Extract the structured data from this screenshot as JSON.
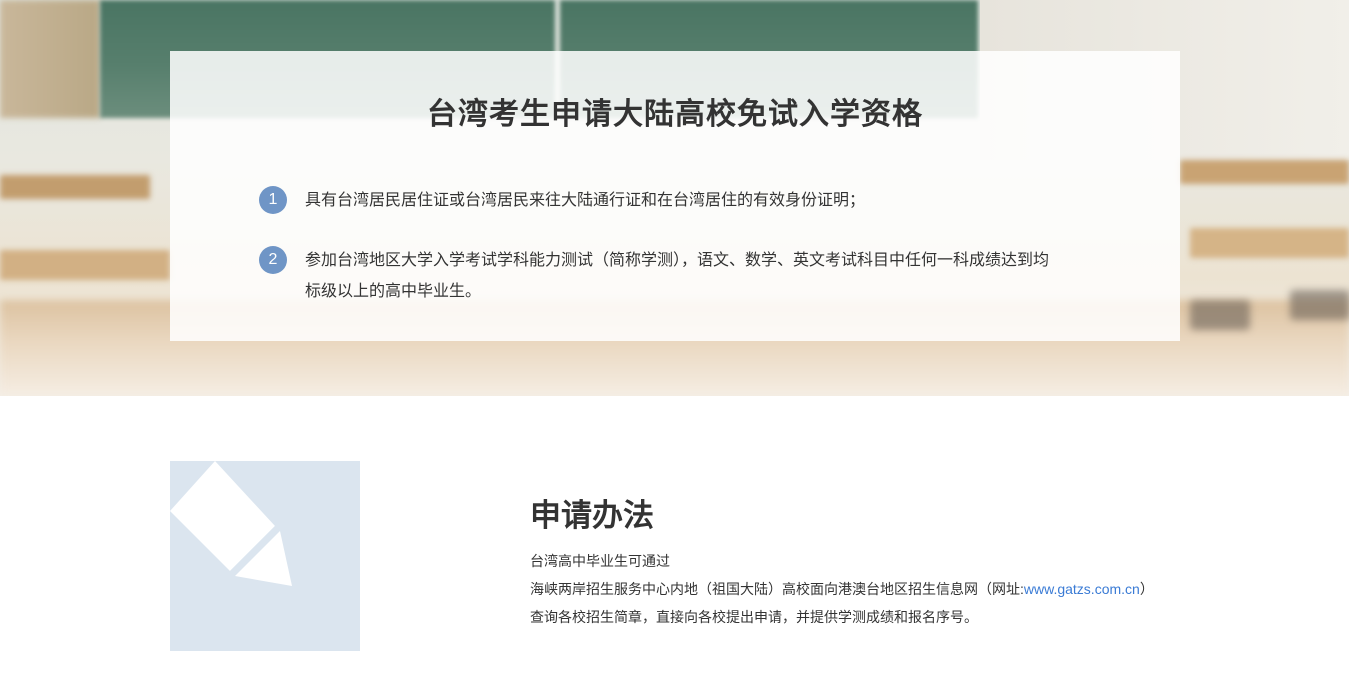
{
  "qualification": {
    "title": "台湾考生申请大陆高校免试入学资格",
    "requirements": [
      {
        "number": "1",
        "text": "具有台湾居民居住证或台湾居民来往大陆通行证和在台湾居住的有效身份证明；"
      },
      {
        "number": "2",
        "text": "参加台湾地区大学入学考试学科能力测试（简称学测），语文、数学、英文考试科目中任何一科成绩达到均标级以上的高中毕业生。"
      }
    ]
  },
  "apply": {
    "icon": "pencil-icon",
    "title": "申请办法",
    "line1": "台湾高中毕业生可通过",
    "line2_before": "海峡两岸招生服务中心内地（祖国大陆）高校面向港澳台地区招生信息网（网址:",
    "line2_link": "www.gatzs.com.cn",
    "line2_after": "）",
    "line3": "查询各校招生简章，直接向各校提出申请，并提供学测成绩和报名序号。"
  },
  "colors": {
    "accent": "#6f95c6",
    "link": "#3a7bd5",
    "icon_bg": "#dbe5ef",
    "text": "#333333"
  }
}
